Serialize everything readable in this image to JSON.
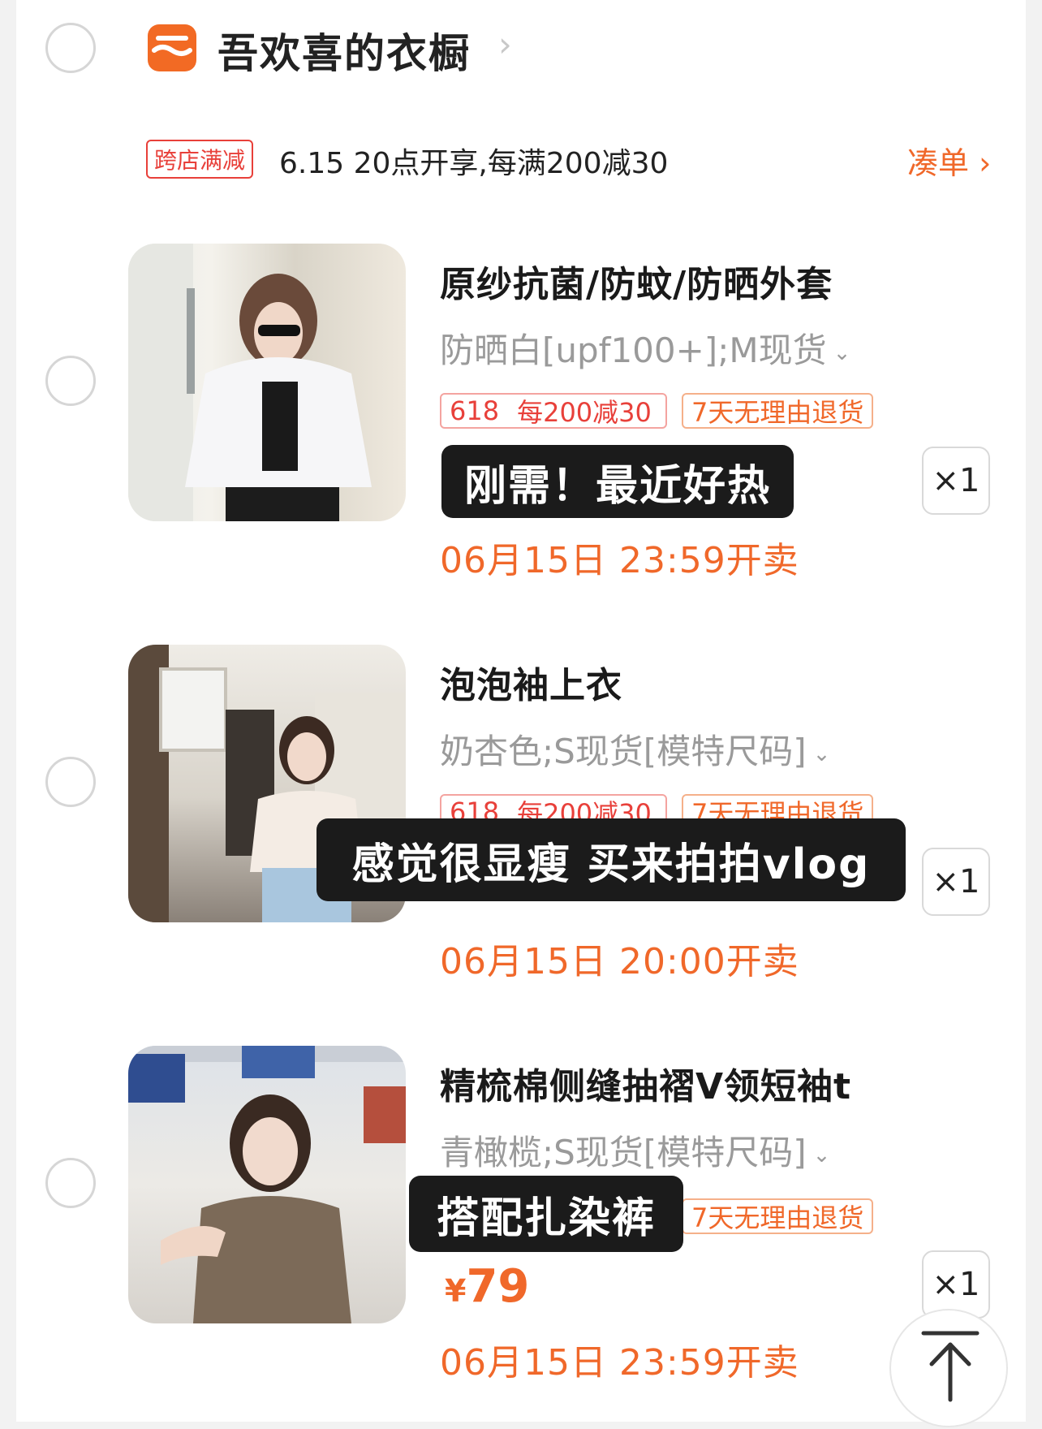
{
  "store": {
    "name": "吾欢喜的衣橱",
    "chevron": "›"
  },
  "promo": {
    "tag": "跨店满减",
    "text": "6.15 20点开享,每满200减30",
    "action": "凑单 ›"
  },
  "items": [
    {
      "title": "原纱抗菌/防蚊/防晒外套",
      "sku": "防晒白[upf100+];M现货",
      "badge_618": "618",
      "badge_discount": "每200减30",
      "badge_return": "7天无理由退货",
      "overlay": "刚需！最近好热",
      "qty": "×1",
      "sale_time": "06月15日 23:59开卖"
    },
    {
      "title": "泡泡袖上衣",
      "sku": "奶杏色;S现货[模特尺码]",
      "badge_618": "618",
      "badge_discount": "每200减30",
      "badge_return": "7天无理由退货",
      "overlay": "感觉很显瘦 买来拍拍vlog",
      "qty": "×1",
      "sale_time": "06月15日 20:00开卖"
    },
    {
      "title": "精梳棉侧缝抽褶V领短袖t",
      "sku": "青橄榄;S现货[模特尺码]",
      "badge_return": "7天无理由退货",
      "overlay": "搭配扎染裤",
      "price_symbol": "¥",
      "price": "79",
      "qty": "×1",
      "sale_time": "06月15日 23:59开卖"
    }
  ],
  "colors": {
    "accent": "#f0682a",
    "red": "#e8403a",
    "overlay": "#1b1b1b"
  }
}
